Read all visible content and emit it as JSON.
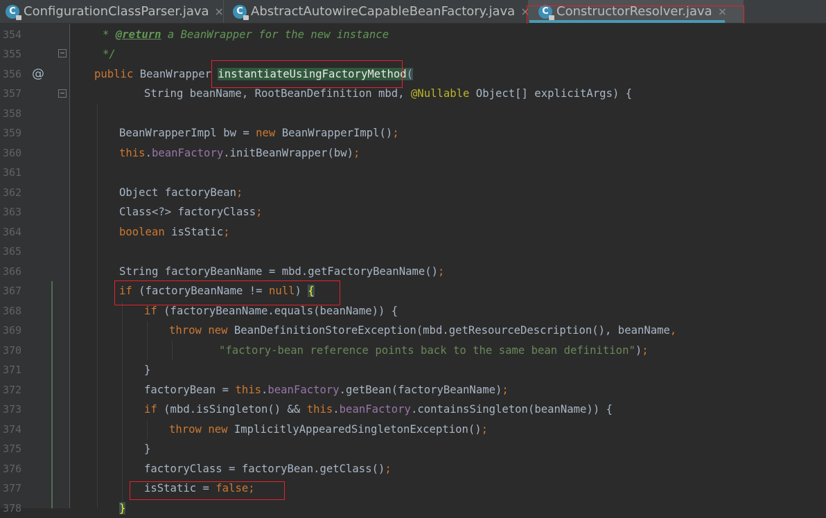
{
  "tabs": [
    {
      "label": "ConfigurationClassParser.java",
      "icon": "class-file-icon",
      "active": false
    },
    {
      "label": "AbstractAutowireCapableBeanFactory.java",
      "icon": "class-file-icon",
      "active": false
    },
    {
      "label": "ConstructorResolver.java",
      "icon": "class-file-icon",
      "active": true
    }
  ],
  "tab_close_glyph": "×",
  "class_icon_letter": "C",
  "colors": {
    "background": "#2b2b2b",
    "keyword": "#cc7832",
    "field": "#9876aa",
    "string": "#6a8759",
    "annotation": "#bbb529",
    "highlight_box": "#e8212b",
    "active_tab_underline": "#4a9ab5"
  },
  "gutter": {
    "override_marker": "@"
  },
  "lines": [
    {
      "n": "354"
    },
    {
      "n": "355"
    },
    {
      "n": "356"
    },
    {
      "n": "357"
    },
    {
      "n": "358"
    },
    {
      "n": "359"
    },
    {
      "n": "360"
    },
    {
      "n": "361"
    },
    {
      "n": "362"
    },
    {
      "n": "363"
    },
    {
      "n": "364"
    },
    {
      "n": "365"
    },
    {
      "n": "366"
    },
    {
      "n": "367"
    },
    {
      "n": "368"
    },
    {
      "n": "369"
    },
    {
      "n": "370"
    },
    {
      "n": "371"
    },
    {
      "n": "372"
    },
    {
      "n": "373"
    },
    {
      "n": "374"
    },
    {
      "n": "375"
    },
    {
      "n": "376"
    },
    {
      "n": "377"
    },
    {
      "n": "378"
    }
  ],
  "code": {
    "l354": {
      "star": "* ",
      "tag": "@return",
      "rest": " a BeanWrapper for the new instance"
    },
    "l355": {
      "text": "*/"
    },
    "l356": {
      "kw": "public",
      "type": " BeanWrapper ",
      "method": "instantiateUsingFactoryMethod",
      "paren": "("
    },
    "l357": {
      "p1": "String beanName, RootBeanDefinition mbd, ",
      "ann": "@Nullable",
      "p2": " Object[] explicitArgs) {"
    },
    "l359": {
      "a": "BeanWrapperImpl bw = ",
      "kw": "new",
      "b": " BeanWrapperImpl()",
      "semi": ";"
    },
    "l360": {
      "kw": "this",
      "dot": ".",
      "fld": "beanFactory",
      "b": ".initBeanWrapper(bw)",
      "semi": ";"
    },
    "l362": {
      "a": "Object factoryBean",
      "semi": ";"
    },
    "l363": {
      "a": "Class<?> factoryClass",
      "semi": ";"
    },
    "l364": {
      "kw": "boolean",
      "a": " isStatic",
      "semi": ";"
    },
    "l366": {
      "a": "String factoryBeanName = mbd.getFactoryBeanName()",
      "semi": ";"
    },
    "l367": {
      "kw": "if",
      "a": " (factoryBeanName != ",
      "kw2": "null",
      "b": ") ",
      "brace": "{"
    },
    "l368": {
      "kw": "if",
      "a": " (factoryBeanName.equals(beanName)) {"
    },
    "l369": {
      "kw": "throw",
      "kw2": " new",
      "a": " BeanDefinitionStoreException(mbd.getResourceDescription(), beanName",
      "comma": ","
    },
    "l370": {
      "str": "\"factory-bean reference points back to the same bean definition\"",
      "a": ")",
      "semi": ";"
    },
    "l371": {
      "a": "}"
    },
    "l372": {
      "a": "factoryBean = ",
      "kw": "this",
      "dot": ".",
      "fld": "beanFactory",
      "b": ".getBean(factoryBeanName)",
      "semi": ";"
    },
    "l373": {
      "kw": "if",
      "a": " (mbd.isSingleton() && ",
      "kw2": "this",
      "dot": ".",
      "fld": "beanFactory",
      "b": ".containsSingleton(beanName)) {"
    },
    "l374": {
      "kw": "throw",
      "kw2": " new",
      "a": " ImplicitlyAppearedSingletonException()",
      "semi": ";"
    },
    "l375": {
      "a": "}"
    },
    "l376": {
      "a": "factoryClass = factoryBean.getClass()",
      "semi": ";"
    },
    "l377": {
      "a": "isStatic = ",
      "kw": "false",
      "semi": ";"
    },
    "l378": {
      "a": "}"
    }
  }
}
